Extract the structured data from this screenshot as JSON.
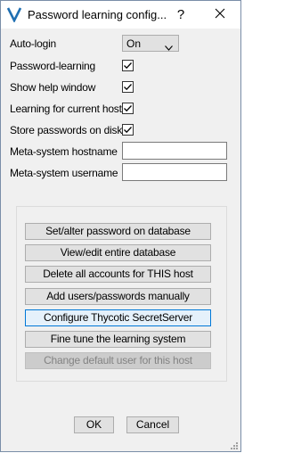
{
  "window": {
    "title": "Password learning config...",
    "help_glyph": "?",
    "close_glyph": "✕",
    "icon": "v-logo-icon"
  },
  "settings": {
    "auto_login": {
      "label": "Auto-login",
      "value": "On"
    },
    "password_learning": {
      "label": "Password-learning",
      "checked": true
    },
    "show_help_window": {
      "label": "Show help window",
      "checked": true
    },
    "learning_current_host": {
      "label": "Learning for current host",
      "checked": true
    },
    "store_passwords": {
      "label": "Store passwords on disk",
      "checked": true
    },
    "meta_hostname": {
      "label": "Meta-system hostname",
      "value": ""
    },
    "meta_username": {
      "label": "Meta-system username",
      "value": ""
    }
  },
  "actions": [
    {
      "label": "Set/alter password on database",
      "state": "normal"
    },
    {
      "label": "View/edit entire database",
      "state": "normal"
    },
    {
      "label": "Delete all accounts for THIS host",
      "state": "normal"
    },
    {
      "label": "Add users/passwords manually",
      "state": "normal"
    },
    {
      "label": "Configure Thycotic SecretServer",
      "state": "focused"
    },
    {
      "label": "Fine tune the learning system",
      "state": "normal"
    },
    {
      "label": "Change default user for this host",
      "state": "disabled"
    }
  ],
  "footer": {
    "ok_label": "OK",
    "cancel_label": "Cancel"
  },
  "colors": {
    "accent": "#0078d7",
    "window_bg": "#f0f0f0",
    "button_bg": "#e1e1e1"
  }
}
